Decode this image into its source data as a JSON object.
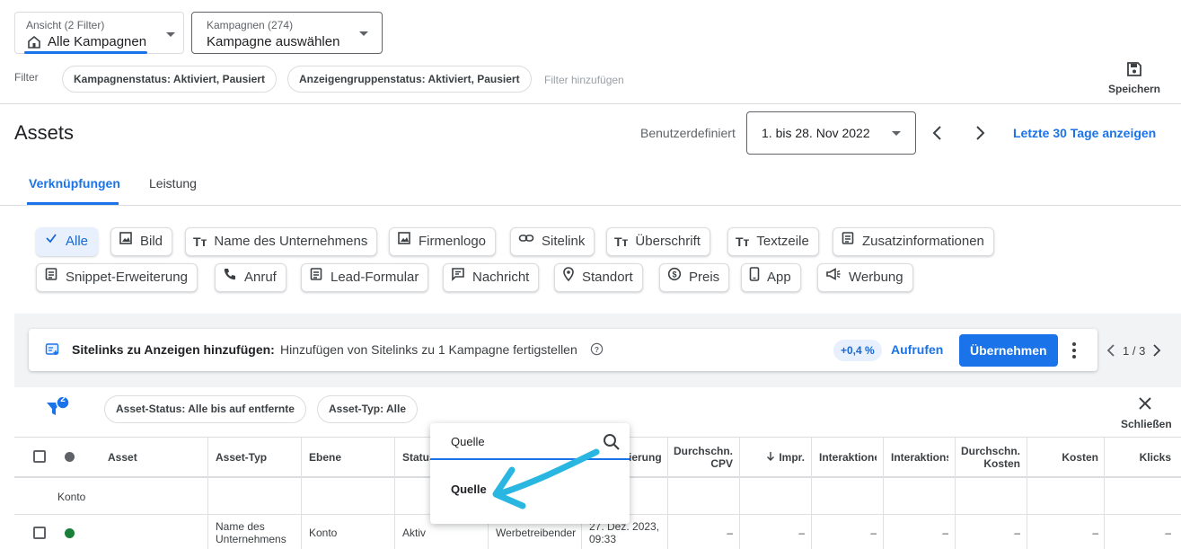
{
  "view_selector": {
    "label": "Ansicht (2 Filter)",
    "value": "Alle Kampagnen"
  },
  "campaign_selector": {
    "label": "Kampagnen (274)",
    "value": "Kampagne auswählen"
  },
  "filter_bar": {
    "label": "Filter",
    "chips": [
      "Kampagnenstatus: Aktiviert, Pausiert",
      "Anzeigengruppenstatus: Aktiviert, Pausiert"
    ],
    "add_placeholder": "Filter hinzufügen"
  },
  "save": {
    "label": "Speichern"
  },
  "page": {
    "title": "Assets"
  },
  "date": {
    "label": "Benutzerdefiniert",
    "range": "1. bis 28. Nov 2022",
    "last30": "Letzte 30 Tage anzeigen"
  },
  "tabs": [
    {
      "label": "Verknüpfungen",
      "active": true
    },
    {
      "label": "Leistung",
      "active": false
    }
  ],
  "asset_types": [
    "Alle",
    "Bild",
    "Name des Unternehmens",
    "Firmenlogo",
    "Sitelink",
    "Überschrift",
    "Textzeile",
    "Zusatzinformationen",
    "Snippet-Erweiterung",
    "Anruf",
    "Lead-Formular",
    "Nachricht",
    "Standort",
    "Preis",
    "App",
    "Werbung"
  ],
  "recommendation": {
    "title": "Sitelinks zu Anzeigen hinzufügen:",
    "text": "Hinzufügen von Sitelinks zu 1 Kampagne fertigstellen",
    "badge": "+0,4 %",
    "view": "Aufrufen",
    "apply": "Übernehmen",
    "pager": "1 / 3"
  },
  "table_filters": {
    "badge_count": "2",
    "chips": [
      "Asset-Status: Alle bis auf entfernte",
      "Asset-Typ: Alle"
    ],
    "close": "Schließen"
  },
  "table": {
    "headers": {
      "asset": "Asset",
      "asset_type": "Asset-Typ",
      "level": "Ebene",
      "status": "Status",
      "hidden_col": "ierung",
      "cpv": "Durchschn. CPV",
      "impr": "Impr.",
      "interactions1": "Interaktione",
      "interactions2": "Interaktions",
      "avg_cost": "Durchschn. Kosten",
      "cost": "Kosten",
      "clicks": "Klicks"
    },
    "group_label": "Konto",
    "row": {
      "asset_type": "Name des Unternehmens",
      "level": "Konto",
      "status": "Aktiv",
      "source": "Werbetreibender",
      "updated": "27. Dez. 2023, 09:33",
      "cpv": "–",
      "impr": "–",
      "interactions1": "–",
      "interactions2": "–",
      "avg_cost": "–",
      "cost": "–",
      "clicks": "–"
    }
  },
  "column_search": {
    "value": "Quelle",
    "result": "Quelle"
  },
  "colors": {
    "accent": "#1a73e8",
    "annotation_arrow": "#29b6e0",
    "status_green": "#188038"
  }
}
